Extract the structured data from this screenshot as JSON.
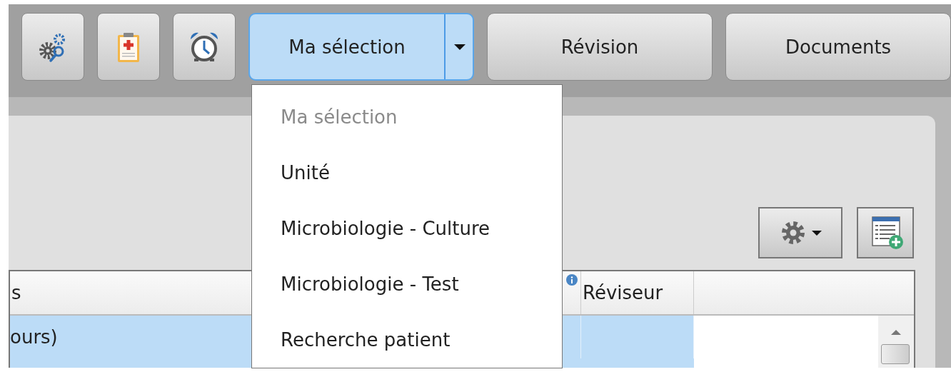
{
  "toolbar": {
    "icon_buttons": [
      {
        "kind": "gears-search"
      },
      {
        "kind": "clipboard"
      },
      {
        "kind": "alarm"
      }
    ],
    "split_button": {
      "label": "Ma sélection",
      "expanded": true
    },
    "buttons": [
      "Révision",
      "Documents"
    ]
  },
  "menu": {
    "items": [
      {
        "label": "Ma sélection",
        "disabled": true
      },
      {
        "label": "Unité",
        "disabled": false
      },
      {
        "label": "Microbiologie - Culture",
        "disabled": false
      },
      {
        "label": "Microbiologie - Test",
        "disabled": false
      },
      {
        "label": "Recherche patient",
        "disabled": false
      }
    ]
  },
  "table": {
    "columns": [
      {
        "kind": "text",
        "label": "s"
      },
      {
        "kind": "info"
      },
      {
        "kind": "text",
        "label": "Réviseur"
      },
      {
        "kind": "blank"
      }
    ],
    "rows": [
      {
        "selected": true,
        "cells": [
          "ours)"
        ]
      }
    ]
  }
}
